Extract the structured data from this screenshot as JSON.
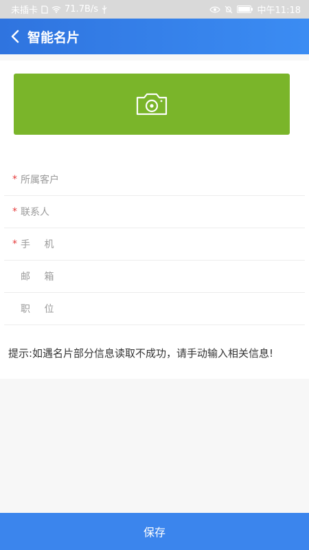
{
  "status_bar": {
    "carrier": "未插卡",
    "speed": "71.7B/s",
    "time": "中午11:18",
    "icons": [
      "sim-icon",
      "wifi-icon",
      "usb-icon",
      "eye-icon",
      "mute-icon",
      "battery-icon"
    ]
  },
  "header": {
    "title": "智能名片",
    "back_icon": "chevron-left-icon"
  },
  "photo": {
    "icon": "camera-icon",
    "color": "#7ab52a"
  },
  "form": {
    "fields": [
      {
        "label": "所属客户",
        "required": true
      },
      {
        "label": "联系人",
        "required": true
      },
      {
        "label": "手 机",
        "required": true
      },
      {
        "label": "邮 箱",
        "required": false
      },
      {
        "label": "职 位",
        "required": false
      }
    ]
  },
  "tip": "提示:如遇名片部分信息读取不成功，请手动输入相关信息!",
  "footer": {
    "save_label": "保存",
    "color": "#3b85ed"
  },
  "colors": {
    "header_start": "#2f74df",
    "header_end": "#3b8cf3",
    "required": "#e53a3a"
  }
}
